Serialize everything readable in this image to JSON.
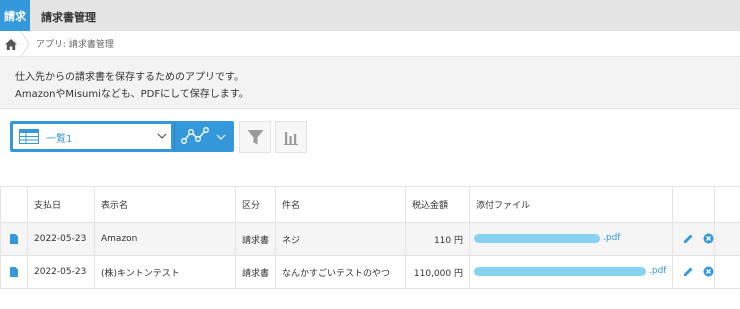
{
  "app": {
    "badge": "請求",
    "title": "請求書管理"
  },
  "breadcrumb": {
    "path": "アプリ: 請求書管理"
  },
  "description": {
    "line1": "仕入先からの請求書を保存するためのアプリです。",
    "line2": "AmazonやMisumiなども、PDFにして保存します。"
  },
  "toolbar": {
    "view_label": "一覧1",
    "icons": [
      "table-icon",
      "chevron-down-icon",
      "graph-icon",
      "filter-icon",
      "bar-chart-icon"
    ],
    "accent_color": "#3498db"
  },
  "table": {
    "columns": [
      "支払日",
      "表示名",
      "区分",
      "件名",
      "税込金額",
      "添付ファイル"
    ],
    "rows": [
      {
        "date": "2022-05-23",
        "name": "Amazon",
        "category": "請求書",
        "subject": "ネジ",
        "amount": "110 円",
        "attachment": ".pdf"
      },
      {
        "date": "2022-05-23",
        "name": "(株)キントンテスト",
        "category": "請求書",
        "subject": "なんかすごいテストのやつ",
        "amount": "110,000 円",
        "attachment": ".pdf"
      }
    ]
  }
}
